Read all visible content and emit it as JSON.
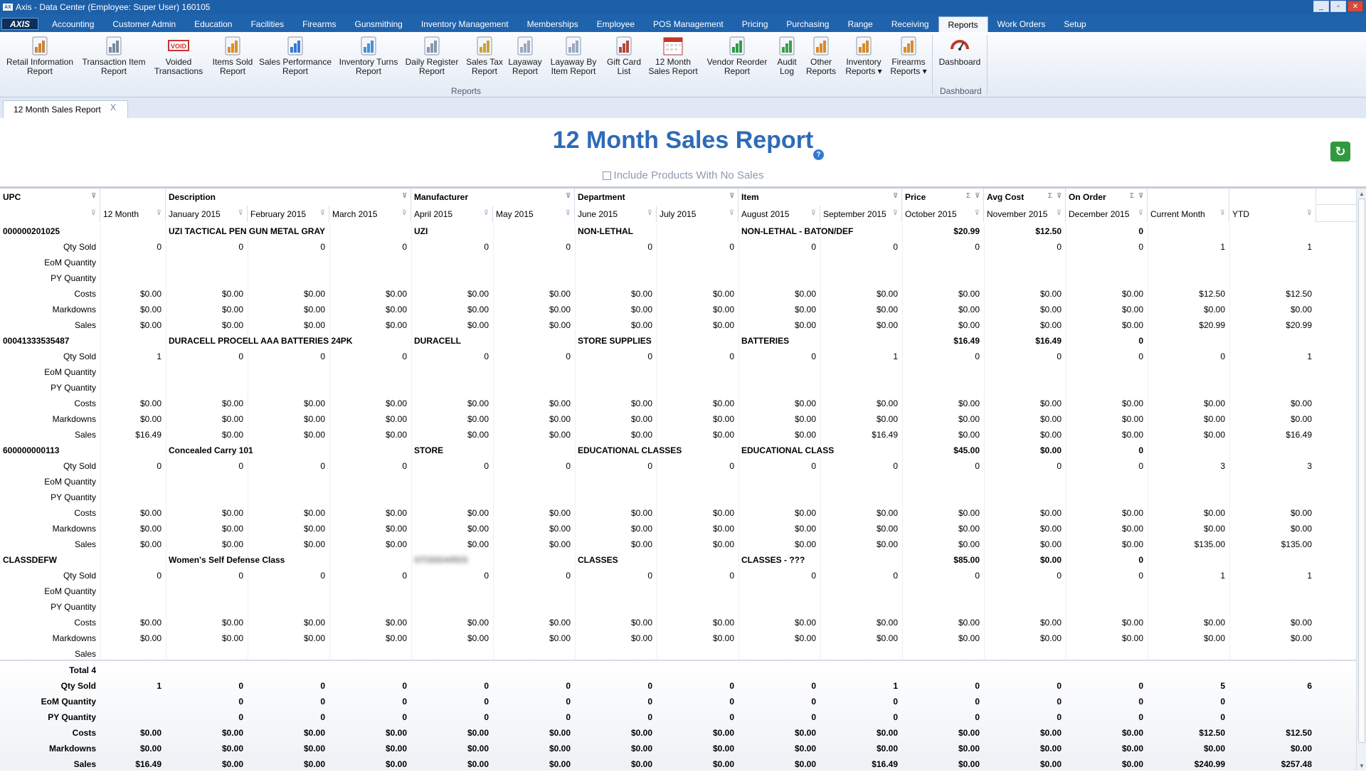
{
  "window": {
    "title": "Axis - Data Center  (Employee: Super User) 160105",
    "logo": "AXIS"
  },
  "menu": [
    "Accounting",
    "Customer Admin",
    "Education",
    "Facilities",
    "Firearms",
    "Gunsmithing",
    "Inventory Management",
    "Memberships",
    "Employee",
    "POS Management",
    "Pricing",
    "Purchasing",
    "Range",
    "Receiving",
    "Reports",
    "Work Orders",
    "Setup"
  ],
  "ribbon": {
    "items": [
      {
        "l1": "Retail Information",
        "l2": "Report",
        "icon": "report-icon"
      },
      {
        "l1": "Transaction Item",
        "l2": "Report",
        "icon": "microphone-icon"
      },
      {
        "l1": "Voided",
        "l2": "Transactions",
        "icon": "void-icon",
        "badge": "VOID"
      },
      {
        "l1": "Items Sold",
        "l2": "Report",
        "icon": "bar-chart-icon"
      },
      {
        "l1": "Sales Performance",
        "l2": "Report",
        "icon": "performance-chart-icon"
      },
      {
        "l1": "Inventory Turns",
        "l2": "Report",
        "icon": "inventory-turns-icon"
      },
      {
        "l1": "Daily Register",
        "l2": "Report",
        "icon": "register-report-icon"
      },
      {
        "l1": "Sales Tax",
        "l2": "Report",
        "icon": "sales-tax-icon"
      },
      {
        "l1": "Layaway",
        "l2": "Report",
        "icon": "layaway-icon"
      },
      {
        "l1": "Layaway By",
        "l2": "Item Report",
        "icon": "layaway-item-icon"
      },
      {
        "l1": "Gift Card",
        "l2": "List",
        "icon": "gift-card-icon"
      },
      {
        "l1": "12 Month",
        "l2": "Sales Report",
        "icon": "calendar-icon"
      },
      {
        "l1": "Vendor Reorder",
        "l2": "Report",
        "icon": "vendor-reorder-icon"
      },
      {
        "l1": "Audit",
        "l2": "Log",
        "icon": "audit-check-icon"
      },
      {
        "l1": "Other",
        "l2": "Reports",
        "icon": "other-reports-icon"
      },
      {
        "l1": "Inventory",
        "l2": "Reports ▾",
        "icon": "inventory-reports-icon"
      },
      {
        "l1": "Firearms",
        "l2": "Reports ▾",
        "icon": "firearms-reports-icon"
      },
      {
        "l1": "Dashboard",
        "l2": "",
        "icon": "dashboard-gauge-icon"
      }
    ],
    "group_reports": "Reports",
    "group_dashboard": "Dashboard"
  },
  "doc_tab": {
    "label": "12 Month Sales Report",
    "close": "X"
  },
  "report": {
    "title": "12 Month Sales Report",
    "help": "?",
    "include_label": "Include Products With No Sales"
  },
  "header_row1": [
    "UPC",
    "",
    "Description",
    "",
    "Manufacturer",
    "",
    "Department",
    "",
    "Item",
    "",
    "Price",
    "Avg Cost",
    "On Order",
    "",
    ""
  ],
  "header_row2": [
    "",
    "12 Month",
    "January 2015",
    "February 2015",
    "March 2015",
    "April 2015",
    "May 2015",
    "June 2015",
    "July 2015",
    "August 2015",
    "September 2015",
    "October 2015",
    "November 2015",
    "December 2015",
    "Current Month",
    "YTD"
  ],
  "metric_labels": [
    "Qty Sold",
    "EoM Quantity",
    "PY Quantity",
    "Costs",
    "Markdowns",
    "Sales"
  ],
  "products": [
    {
      "upc": "000000201025",
      "description": "UZI TACTICAL PEN GUN METAL GRAY",
      "manufacturer": "UZI",
      "department": "NON-LETHAL",
      "item": "NON-LETHAL - BATON/DEF",
      "price": "$20.99",
      "avg_cost": "$12.50",
      "on_order": "0",
      "qty": [
        "0",
        "0",
        "0",
        "0",
        "0",
        "0",
        "0",
        "0",
        "0",
        "0",
        "0",
        "0",
        "0",
        "1",
        "1"
      ],
      "costs": [
        "$0.00",
        "$0.00",
        "$0.00",
        "$0.00",
        "$0.00",
        "$0.00",
        "$0.00",
        "$0.00",
        "$0.00",
        "$0.00",
        "$0.00",
        "$0.00",
        "$0.00",
        "$12.50",
        "$12.50"
      ],
      "markdowns": [
        "$0.00",
        "$0.00",
        "$0.00",
        "$0.00",
        "$0.00",
        "$0.00",
        "$0.00",
        "$0.00",
        "$0.00",
        "$0.00",
        "$0.00",
        "$0.00",
        "$0.00",
        "$0.00",
        "$0.00"
      ],
      "sales": [
        "$0.00",
        "$0.00",
        "$0.00",
        "$0.00",
        "$0.00",
        "$0.00",
        "$0.00",
        "$0.00",
        "$0.00",
        "$0.00",
        "$0.00",
        "$0.00",
        "$0.00",
        "$20.99",
        "$20.99"
      ]
    },
    {
      "upc": "00041333535487",
      "description": "DURACELL PROCELL AAA BATTERIES 24PK",
      "manufacturer": "DURACELL",
      "department": "STORE SUPPLIES",
      "item": "BATTERIES",
      "price": "$16.49",
      "avg_cost": "$16.49",
      "on_order": "0",
      "qty": [
        "1",
        "0",
        "0",
        "0",
        "0",
        "0",
        "0",
        "0",
        "0",
        "1",
        "0",
        "0",
        "0",
        "0",
        "1"
      ],
      "costs": [
        "$0.00",
        "$0.00",
        "$0.00",
        "$0.00",
        "$0.00",
        "$0.00",
        "$0.00",
        "$0.00",
        "$0.00",
        "$0.00",
        "$0.00",
        "$0.00",
        "$0.00",
        "$0.00",
        "$0.00"
      ],
      "markdowns": [
        "$0.00",
        "$0.00",
        "$0.00",
        "$0.00",
        "$0.00",
        "$0.00",
        "$0.00",
        "$0.00",
        "$0.00",
        "$0.00",
        "$0.00",
        "$0.00",
        "$0.00",
        "$0.00",
        "$0.00"
      ],
      "sales": [
        "$16.49",
        "$0.00",
        "$0.00",
        "$0.00",
        "$0.00",
        "$0.00",
        "$0.00",
        "$0.00",
        "$0.00",
        "$16.49",
        "$0.00",
        "$0.00",
        "$0.00",
        "$0.00",
        "$16.49"
      ]
    },
    {
      "upc": "600000000113",
      "description": "Concealed Carry 101",
      "manufacturer": "STORE",
      "department": "EDUCATIONAL CLASSES",
      "item": "EDUCATIONAL CLASS",
      "price": "$45.00",
      "avg_cost": "$0.00",
      "on_order": "0",
      "qty": [
        "0",
        "0",
        "0",
        "0",
        "0",
        "0",
        "0",
        "0",
        "0",
        "0",
        "0",
        "0",
        "0",
        "3",
        "3"
      ],
      "costs": [
        "$0.00",
        "$0.00",
        "$0.00",
        "$0.00",
        "$0.00",
        "$0.00",
        "$0.00",
        "$0.00",
        "$0.00",
        "$0.00",
        "$0.00",
        "$0.00",
        "$0.00",
        "$0.00",
        "$0.00"
      ],
      "markdowns": [
        "$0.00",
        "$0.00",
        "$0.00",
        "$0.00",
        "$0.00",
        "$0.00",
        "$0.00",
        "$0.00",
        "$0.00",
        "$0.00",
        "$0.00",
        "$0.00",
        "$0.00",
        "$0.00",
        "$0.00"
      ],
      "sales": [
        "$0.00",
        "$0.00",
        "$0.00",
        "$0.00",
        "$0.00",
        "$0.00",
        "$0.00",
        "$0.00",
        "$0.00",
        "$0.00",
        "$0.00",
        "$0.00",
        "$0.00",
        "$135.00",
        "$135.00"
      ]
    },
    {
      "upc": "CLASSDEFW",
      "description": "Women's Self Defense Class",
      "manufacturer": "STODDARDS",
      "department": "CLASSES",
      "item": "CLASSES - ???",
      "price": "$85.00",
      "avg_cost": "$0.00",
      "on_order": "0",
      "qty": [
        "0",
        "0",
        "0",
        "0",
        "0",
        "0",
        "0",
        "0",
        "0",
        "0",
        "0",
        "0",
        "0",
        "1",
        "1"
      ],
      "costs": [
        "$0.00",
        "$0.00",
        "$0.00",
        "$0.00",
        "$0.00",
        "$0.00",
        "$0.00",
        "$0.00",
        "$0.00",
        "$0.00",
        "$0.00",
        "$0.00",
        "$0.00",
        "$0.00",
        "$0.00"
      ],
      "markdowns": [
        "$0.00",
        "$0.00",
        "$0.00",
        "$0.00",
        "$0.00",
        "$0.00",
        "$0.00",
        "$0.00",
        "$0.00",
        "$0.00",
        "$0.00",
        "$0.00",
        "$0.00",
        "$0.00",
        "$0.00"
      ],
      "sales": []
    }
  ],
  "totals": {
    "label": "Total 4",
    "qty": [
      "1",
      "0",
      "0",
      "0",
      "0",
      "0",
      "0",
      "0",
      "0",
      "1",
      "0",
      "0",
      "0",
      "5",
      "6"
    ],
    "eom": [
      "",
      "0",
      "0",
      "0",
      "0",
      "0",
      "0",
      "0",
      "0",
      "0",
      "0",
      "0",
      "0",
      "0",
      ""
    ],
    "py": [
      "",
      "0",
      "0",
      "0",
      "0",
      "0",
      "0",
      "0",
      "0",
      "0",
      "0",
      "0",
      "0",
      "0",
      ""
    ],
    "costs": [
      "$0.00",
      "$0.00",
      "$0.00",
      "$0.00",
      "$0.00",
      "$0.00",
      "$0.00",
      "$0.00",
      "$0.00",
      "$0.00",
      "$0.00",
      "$0.00",
      "$0.00",
      "$12.50",
      "$12.50"
    ],
    "markdowns": [
      "$0.00",
      "$0.00",
      "$0.00",
      "$0.00",
      "$0.00",
      "$0.00",
      "$0.00",
      "$0.00",
      "$0.00",
      "$0.00",
      "$0.00",
      "$0.00",
      "$0.00",
      "$0.00",
      "$0.00"
    ],
    "sales": [
      "$16.49",
      "$0.00",
      "$0.00",
      "$0.00",
      "$0.00",
      "$0.00",
      "$0.00",
      "$0.00",
      "$0.00",
      "$16.49",
      "$0.00",
      "$0.00",
      "$0.00",
      "$240.99",
      "$257.48"
    ]
  },
  "colors": {
    "accent": "#2e6bb8",
    "titlebar": "#1d5fa8",
    "refresh": "#2f9a3e"
  }
}
